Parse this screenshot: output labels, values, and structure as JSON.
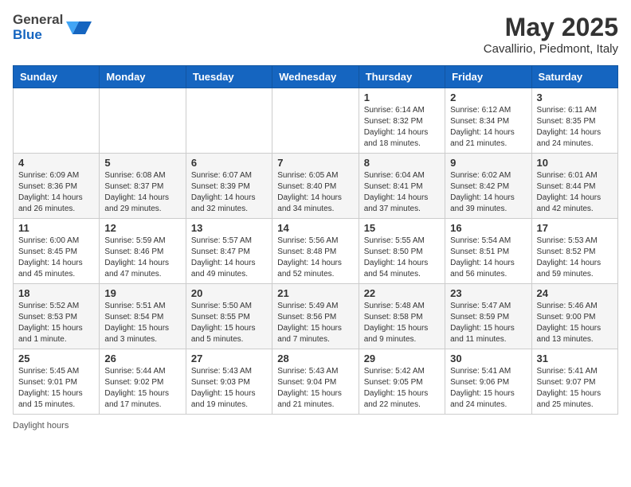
{
  "header": {
    "logo_line1": "General",
    "logo_line2": "Blue",
    "month_title": "May 2025",
    "subtitle": "Cavallirio, Piedmont, Italy"
  },
  "days_of_week": [
    "Sunday",
    "Monday",
    "Tuesday",
    "Wednesday",
    "Thursday",
    "Friday",
    "Saturday"
  ],
  "weeks": [
    [
      {
        "day": "",
        "info": ""
      },
      {
        "day": "",
        "info": ""
      },
      {
        "day": "",
        "info": ""
      },
      {
        "day": "",
        "info": ""
      },
      {
        "day": "1",
        "info": "Sunrise: 6:14 AM\nSunset: 8:32 PM\nDaylight: 14 hours\nand 18 minutes."
      },
      {
        "day": "2",
        "info": "Sunrise: 6:12 AM\nSunset: 8:34 PM\nDaylight: 14 hours\nand 21 minutes."
      },
      {
        "day": "3",
        "info": "Sunrise: 6:11 AM\nSunset: 8:35 PM\nDaylight: 14 hours\nand 24 minutes."
      }
    ],
    [
      {
        "day": "4",
        "info": "Sunrise: 6:09 AM\nSunset: 8:36 PM\nDaylight: 14 hours\nand 26 minutes."
      },
      {
        "day": "5",
        "info": "Sunrise: 6:08 AM\nSunset: 8:37 PM\nDaylight: 14 hours\nand 29 minutes."
      },
      {
        "day": "6",
        "info": "Sunrise: 6:07 AM\nSunset: 8:39 PM\nDaylight: 14 hours\nand 32 minutes."
      },
      {
        "day": "7",
        "info": "Sunrise: 6:05 AM\nSunset: 8:40 PM\nDaylight: 14 hours\nand 34 minutes."
      },
      {
        "day": "8",
        "info": "Sunrise: 6:04 AM\nSunset: 8:41 PM\nDaylight: 14 hours\nand 37 minutes."
      },
      {
        "day": "9",
        "info": "Sunrise: 6:02 AM\nSunset: 8:42 PM\nDaylight: 14 hours\nand 39 minutes."
      },
      {
        "day": "10",
        "info": "Sunrise: 6:01 AM\nSunset: 8:44 PM\nDaylight: 14 hours\nand 42 minutes."
      }
    ],
    [
      {
        "day": "11",
        "info": "Sunrise: 6:00 AM\nSunset: 8:45 PM\nDaylight: 14 hours\nand 45 minutes."
      },
      {
        "day": "12",
        "info": "Sunrise: 5:59 AM\nSunset: 8:46 PM\nDaylight: 14 hours\nand 47 minutes."
      },
      {
        "day": "13",
        "info": "Sunrise: 5:57 AM\nSunset: 8:47 PM\nDaylight: 14 hours\nand 49 minutes."
      },
      {
        "day": "14",
        "info": "Sunrise: 5:56 AM\nSunset: 8:48 PM\nDaylight: 14 hours\nand 52 minutes."
      },
      {
        "day": "15",
        "info": "Sunrise: 5:55 AM\nSunset: 8:50 PM\nDaylight: 14 hours\nand 54 minutes."
      },
      {
        "day": "16",
        "info": "Sunrise: 5:54 AM\nSunset: 8:51 PM\nDaylight: 14 hours\nand 56 minutes."
      },
      {
        "day": "17",
        "info": "Sunrise: 5:53 AM\nSunset: 8:52 PM\nDaylight: 14 hours\nand 59 minutes."
      }
    ],
    [
      {
        "day": "18",
        "info": "Sunrise: 5:52 AM\nSunset: 8:53 PM\nDaylight: 15 hours\nand 1 minute."
      },
      {
        "day": "19",
        "info": "Sunrise: 5:51 AM\nSunset: 8:54 PM\nDaylight: 15 hours\nand 3 minutes."
      },
      {
        "day": "20",
        "info": "Sunrise: 5:50 AM\nSunset: 8:55 PM\nDaylight: 15 hours\nand 5 minutes."
      },
      {
        "day": "21",
        "info": "Sunrise: 5:49 AM\nSunset: 8:56 PM\nDaylight: 15 hours\nand 7 minutes."
      },
      {
        "day": "22",
        "info": "Sunrise: 5:48 AM\nSunset: 8:58 PM\nDaylight: 15 hours\nand 9 minutes."
      },
      {
        "day": "23",
        "info": "Sunrise: 5:47 AM\nSunset: 8:59 PM\nDaylight: 15 hours\nand 11 minutes."
      },
      {
        "day": "24",
        "info": "Sunrise: 5:46 AM\nSunset: 9:00 PM\nDaylight: 15 hours\nand 13 minutes."
      }
    ],
    [
      {
        "day": "25",
        "info": "Sunrise: 5:45 AM\nSunset: 9:01 PM\nDaylight: 15 hours\nand 15 minutes."
      },
      {
        "day": "26",
        "info": "Sunrise: 5:44 AM\nSunset: 9:02 PM\nDaylight: 15 hours\nand 17 minutes."
      },
      {
        "day": "27",
        "info": "Sunrise: 5:43 AM\nSunset: 9:03 PM\nDaylight: 15 hours\nand 19 minutes."
      },
      {
        "day": "28",
        "info": "Sunrise: 5:43 AM\nSunset: 9:04 PM\nDaylight: 15 hours\nand 21 minutes."
      },
      {
        "day": "29",
        "info": "Sunrise: 5:42 AM\nSunset: 9:05 PM\nDaylight: 15 hours\nand 22 minutes."
      },
      {
        "day": "30",
        "info": "Sunrise: 5:41 AM\nSunset: 9:06 PM\nDaylight: 15 hours\nand 24 minutes."
      },
      {
        "day": "31",
        "info": "Sunrise: 5:41 AM\nSunset: 9:07 PM\nDaylight: 15 hours\nand 25 minutes."
      }
    ]
  ],
  "footer": {
    "daylight_label": "Daylight hours"
  }
}
